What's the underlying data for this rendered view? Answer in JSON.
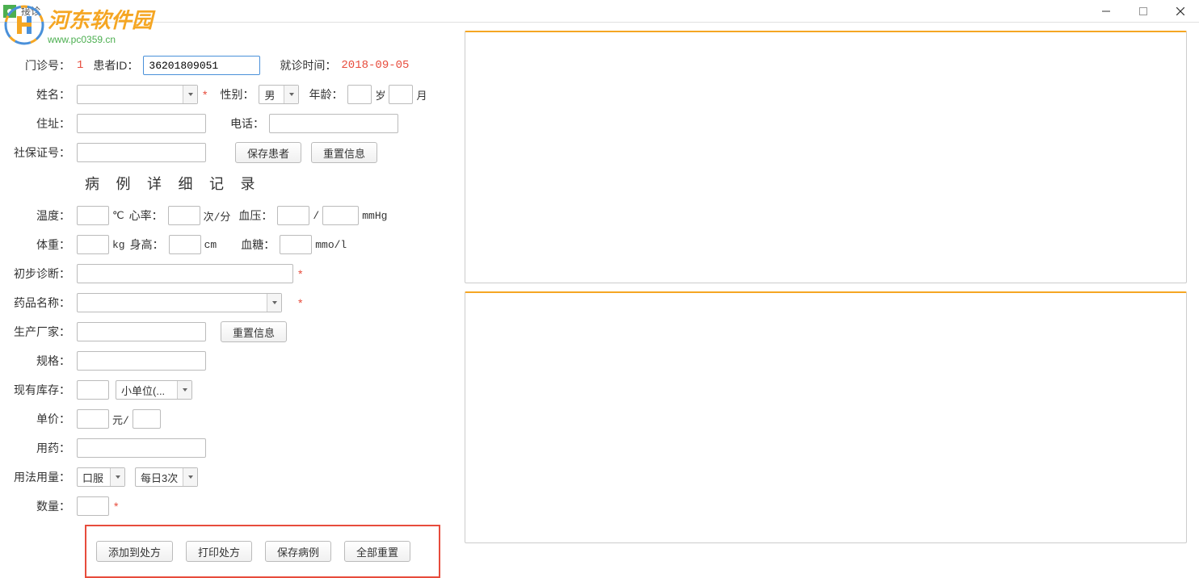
{
  "window": {
    "title": "接诊"
  },
  "logo": {
    "main": "河东软件园",
    "url": "www.pc0359.cn"
  },
  "patient": {
    "labels": {
      "clinic_no": "门诊号：",
      "patient_id": "患者ID：",
      "visit_time": "就诊时间：",
      "name": "姓名：",
      "gender": "性别：",
      "age": "年龄：",
      "years": "岁",
      "months": "月",
      "address": "住址：",
      "phone": "电话：",
      "ssn": "社保证号："
    },
    "values": {
      "clinic_no": "1",
      "patient_id": "36201809051",
      "visit_time": "2018-09-05",
      "gender": "男"
    },
    "buttons": {
      "save": "保存患者",
      "reset": "重置信息"
    }
  },
  "case_record": {
    "title": "病 例 详 细 记 录",
    "labels": {
      "temperature": "温度：",
      "temp_unit": "℃",
      "heart_rate": "心率：",
      "hr_unit": "次/分",
      "blood_pressure": "血压：",
      "bp_sep": "/",
      "bp_unit": "mmHg",
      "weight": "体重：",
      "weight_unit": "kg",
      "height": "身高：",
      "height_unit": "cm",
      "blood_sugar": "血糖：",
      "bs_unit": "mmo/l",
      "diagnosis": "初步诊断：",
      "drug_name": "药品名称：",
      "manufacturer": "生产厂家：",
      "spec": "规格：",
      "stock": "现有库存：",
      "small_unit": "小单位(...",
      "price": "单价：",
      "yuan_per": "元/",
      "medication": "用药：",
      "usage": "用法用量：",
      "route": "口服",
      "frequency": "每日3次",
      "quantity": "数量："
    },
    "buttons": {
      "reset_info": "重置信息",
      "add_rx": "添加到处方",
      "print_rx": "打印处方",
      "save_case": "保存病例",
      "reset_all": "全部重置"
    }
  }
}
